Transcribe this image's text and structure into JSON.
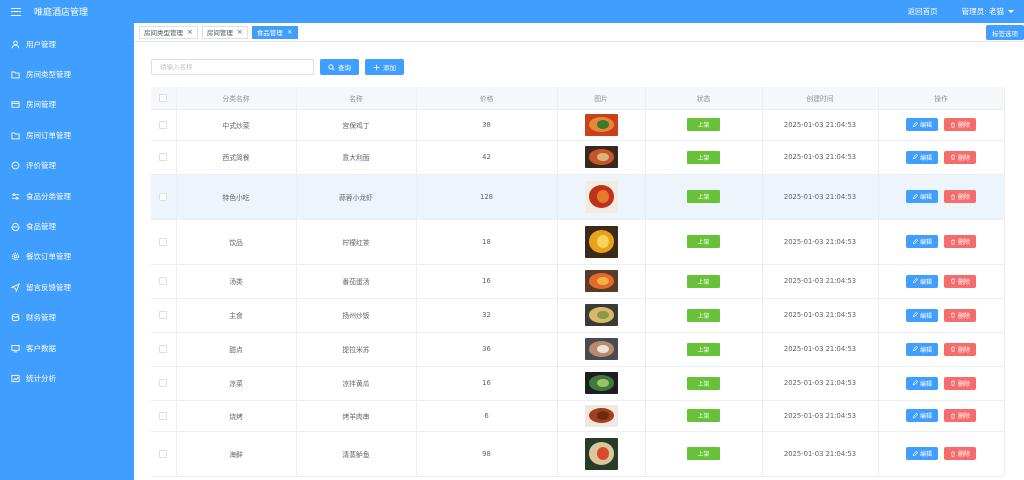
{
  "header": {
    "title": "唯庭酒店管理",
    "home_link": "返回首页",
    "admin_label": "管理员: 老猫"
  },
  "sidebar": {
    "items": [
      {
        "label": "用户管理",
        "icon": "user-icon"
      },
      {
        "label": "房间类型管理",
        "icon": "folder-icon"
      },
      {
        "label": "房间管理",
        "icon": "card-icon"
      },
      {
        "label": "房间订单管理",
        "icon": "folder-icon"
      },
      {
        "label": "评价管理",
        "icon": "chat-icon"
      },
      {
        "label": "食品分类管理",
        "icon": "sliders-icon"
      },
      {
        "label": "食品管理",
        "icon": "food-icon"
      },
      {
        "label": "餐饮订单管理",
        "icon": "settings-icon"
      },
      {
        "label": "留言反馈管理",
        "icon": "send-icon"
      },
      {
        "label": "财务管理",
        "icon": "coin-icon"
      },
      {
        "label": "客户数据",
        "icon": "monitor-icon"
      },
      {
        "label": "统计分析",
        "icon": "chart-icon"
      }
    ]
  },
  "tabs": [
    {
      "label": "房间类型管理",
      "active": false
    },
    {
      "label": "房间管理",
      "active": false
    },
    {
      "label": "食品管理",
      "active": true
    }
  ],
  "tab_close_all": "标签选项",
  "toolbar": {
    "search_placeholder": "请输入名称",
    "search_label": "查询",
    "add_label": "添加"
  },
  "table": {
    "columns": [
      "分类名称",
      "名称",
      "价格",
      "图片",
      "状态",
      "创建时间",
      "操作"
    ],
    "edit_label": "编辑",
    "delete_label": "删除",
    "rows": [
      {
        "category": "中式炒菜",
        "name": "宫保鸡丁",
        "price": "38",
        "status": "上架",
        "created": "2025-01-03 21:04:53",
        "img_colors": [
          "#c8401c",
          "#e9853a",
          "#3a7a2a"
        ]
      },
      {
        "category": "西式简餐",
        "name": "意大利面",
        "price": "42",
        "status": "上架",
        "created": "2025-01-03 21:04:53",
        "img_colors": [
          "#3a2a1e",
          "#c8552a",
          "#d9b27a"
        ]
      },
      {
        "category": "特色小吃",
        "name": "蒜蓉小龙虾",
        "price": "128",
        "status": "上架",
        "created": "2025-01-03 21:04:53",
        "img_colors": [
          "#f2ebe0",
          "#c0301e",
          "#e47a2a"
        ]
      },
      {
        "category": "饮品",
        "name": "柠檬红茶",
        "price": "18",
        "status": "上架",
        "created": "2025-01-03 21:04:53",
        "img_colors": [
          "#3a2a18",
          "#e8a21a",
          "#f4d35e"
        ]
      },
      {
        "category": "汤类",
        "name": "番茄蛋汤",
        "price": "16",
        "status": "上架",
        "created": "2025-01-03 21:04:53",
        "img_colors": [
          "#5a3a28",
          "#e36a2a",
          "#f3b243"
        ]
      },
      {
        "category": "主食",
        "name": "扬州炒饭",
        "price": "32",
        "status": "上架",
        "created": "2025-01-03 21:04:53",
        "img_colors": [
          "#3b3b36",
          "#d9b86a",
          "#8a9a4a"
        ]
      },
      {
        "category": "甜点",
        "name": "提拉米苏",
        "price": "36",
        "status": "上架",
        "created": "2025-01-03 21:04:53",
        "img_colors": [
          "#4a4a52",
          "#b98a6a",
          "#e8e2d8"
        ]
      },
      {
        "category": "凉菜",
        "name": "凉拌黄瓜",
        "price": "16",
        "status": "上架",
        "created": "2025-01-03 21:04:53",
        "img_colors": [
          "#1e1e22",
          "#3f7a3a",
          "#9ac46a"
        ]
      },
      {
        "category": "烧烤",
        "name": "烤羊肉串",
        "price": "6",
        "status": "上架",
        "created": "2025-01-03 21:04:53",
        "img_colors": [
          "#f0e8de",
          "#a0401e",
          "#6a2a14"
        ]
      },
      {
        "category": "海鲜",
        "name": "清蒸鲈鱼",
        "price": "98",
        "status": "上架",
        "created": "2025-01-03 21:04:53",
        "img_colors": [
          "#2a3a2a",
          "#d8c89a",
          "#d94a2a"
        ]
      }
    ]
  },
  "colors": {
    "primary": "#409eff",
    "success": "#67c23a",
    "danger": "#f56c6c"
  }
}
